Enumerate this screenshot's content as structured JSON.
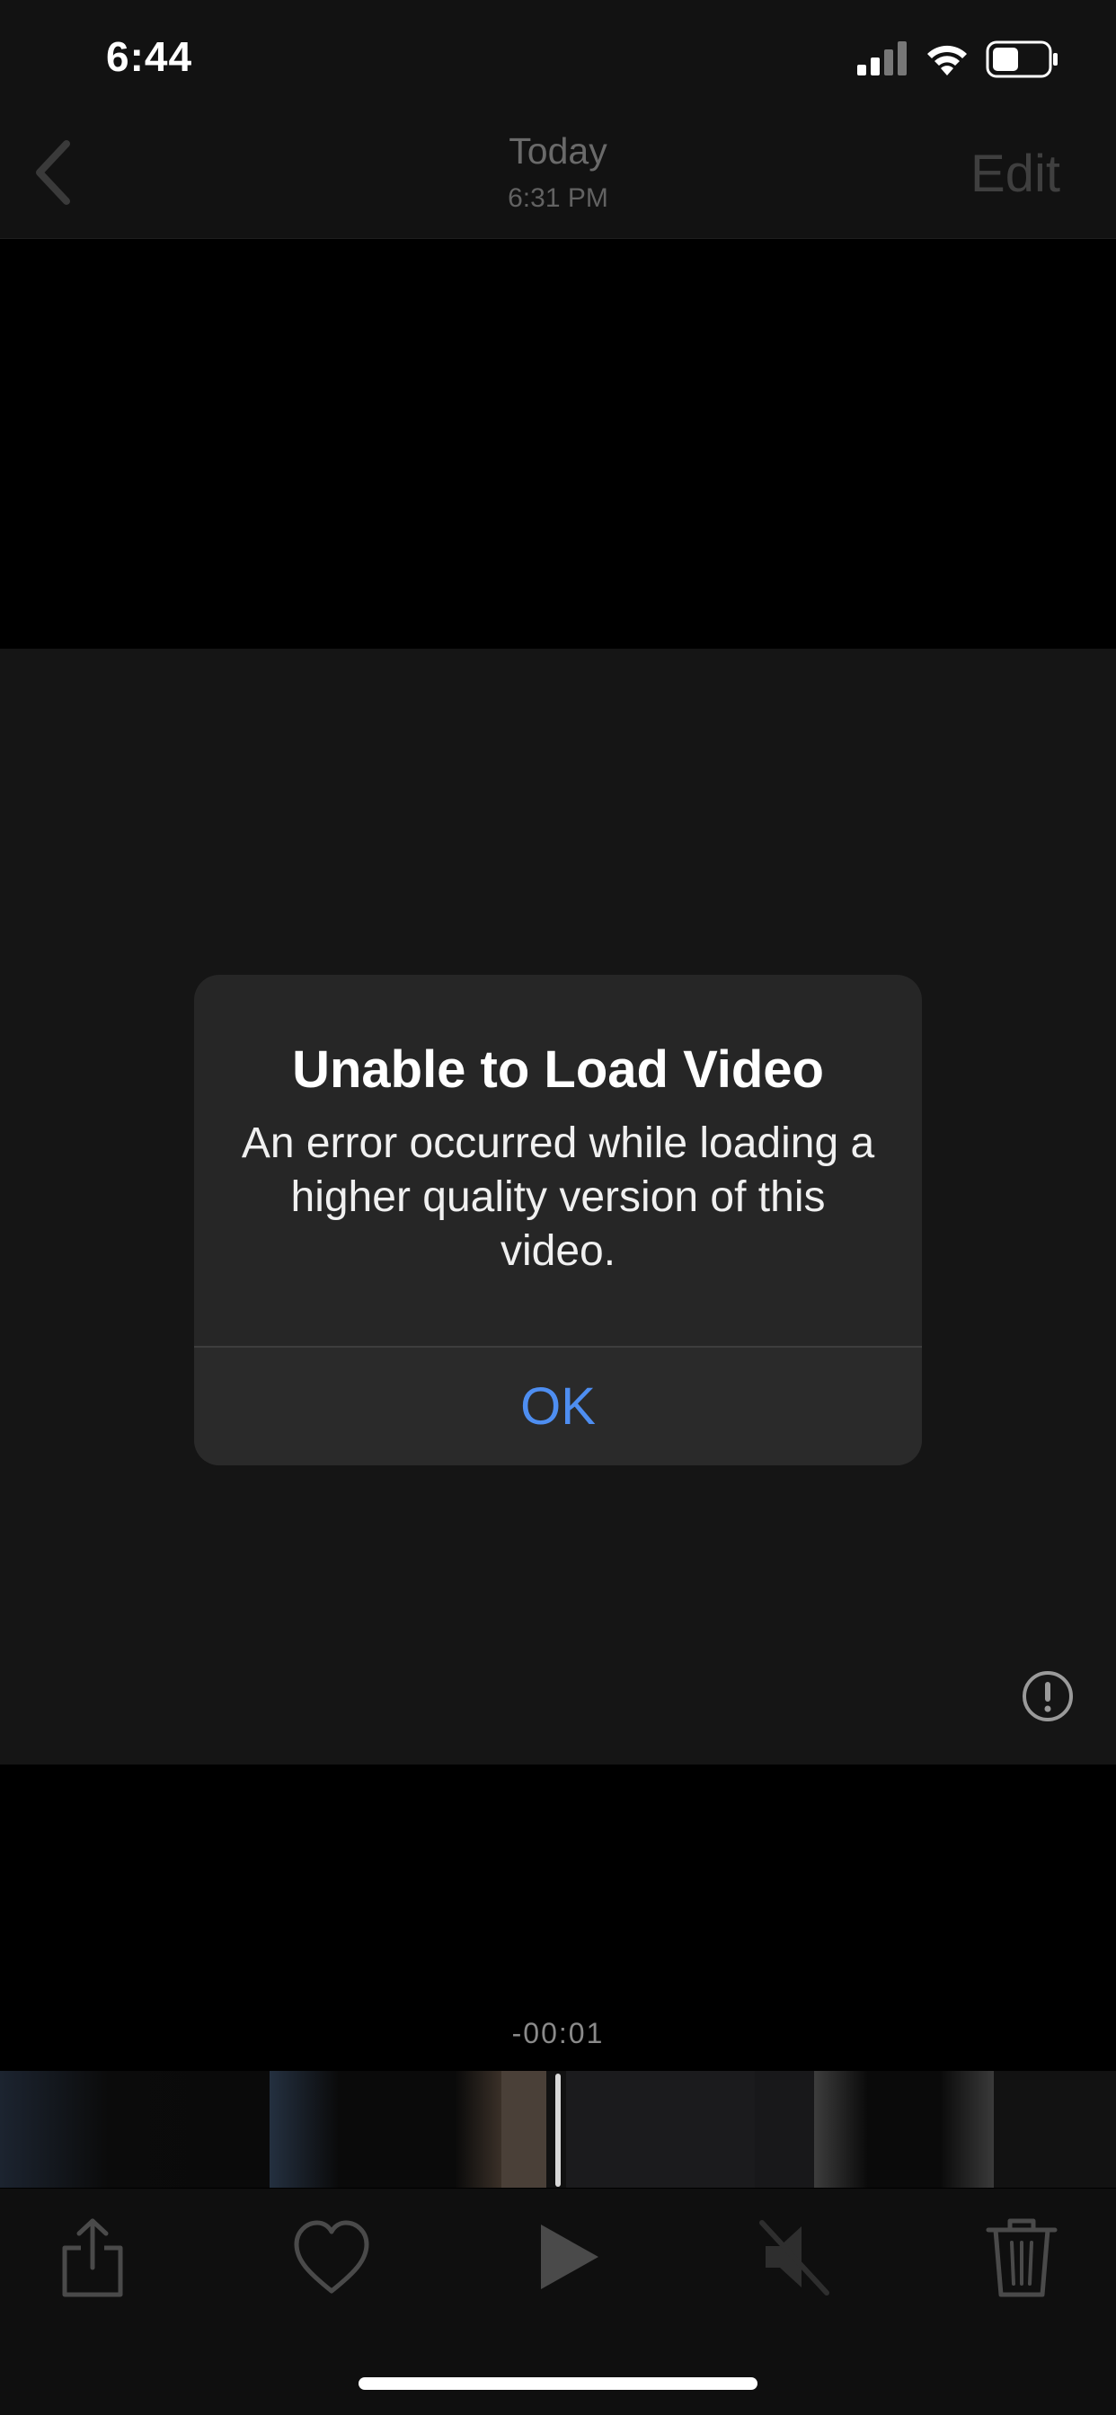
{
  "status_bar": {
    "time": "6:44"
  },
  "nav": {
    "title": "Today",
    "subtitle": "6:31 PM",
    "edit_label": "Edit"
  },
  "alert": {
    "title": "Unable to Load Video",
    "message": "An error occurred while loading a higher quality version of this video.",
    "ok_label": "OK"
  },
  "player": {
    "time_remaining": "-00:01"
  },
  "toolbar": {
    "icons": [
      "share-icon",
      "heart-icon",
      "play-icon",
      "mute-icon",
      "trash-icon"
    ]
  },
  "colors": {
    "accent": "#4e8ef1",
    "alert_bg": "#262626",
    "background": "#000000"
  }
}
